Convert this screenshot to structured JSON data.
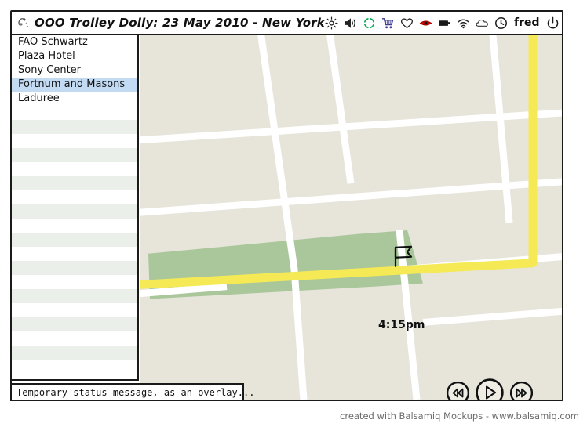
{
  "window": {
    "title": "OOO Trolley Dolly: 23 May 2010 - New York",
    "app_icon": "sketch-app-icon"
  },
  "titlebar": {
    "icons": [
      {
        "name": "brightness-icon",
        "label": "brightness"
      },
      {
        "name": "speaker-icon",
        "label": "volume"
      },
      {
        "name": "location-target-icon",
        "label": "location",
        "color": "#00a651"
      },
      {
        "name": "shopping-cart-icon",
        "label": "cart",
        "color": "#3b3b8f"
      },
      {
        "name": "heart-icon",
        "label": "favorites"
      },
      {
        "name": "eye-icon",
        "label": "visibility",
        "color": "#d50000"
      },
      {
        "name": "battery-icon",
        "label": "battery"
      },
      {
        "name": "wifi-icon",
        "label": "wifi"
      },
      {
        "name": "cloud-icon",
        "label": "cloud"
      },
      {
        "name": "clock-icon",
        "label": "clock"
      }
    ],
    "user": "fred",
    "power_icon": "power-icon"
  },
  "sidebar": {
    "items": [
      {
        "label": "FAO Schwartz",
        "selected": false
      },
      {
        "label": "Plaza Hotel",
        "selected": false
      },
      {
        "label": "Sony Center",
        "selected": false
      },
      {
        "label": "Fortnum and Masons",
        "selected": true
      },
      {
        "label": "Laduree",
        "selected": false
      }
    ],
    "empty_row_count": 19
  },
  "map": {
    "background_color": "#e7e4da",
    "street_color": "#ffffff",
    "highway_color": "#f5ea56",
    "park_color": "#a9c79a",
    "marker": {
      "name": "flag-marker",
      "time_label": "4:15pm"
    }
  },
  "transport": {
    "rewind_label": "rewind",
    "play_label": "play",
    "forward_label": "fast-forward"
  },
  "status": {
    "message": "Temporary status message, as an overlay..."
  },
  "footer": {
    "credit": "created with Balsamiq Mockups - www.balsamiq.com"
  }
}
